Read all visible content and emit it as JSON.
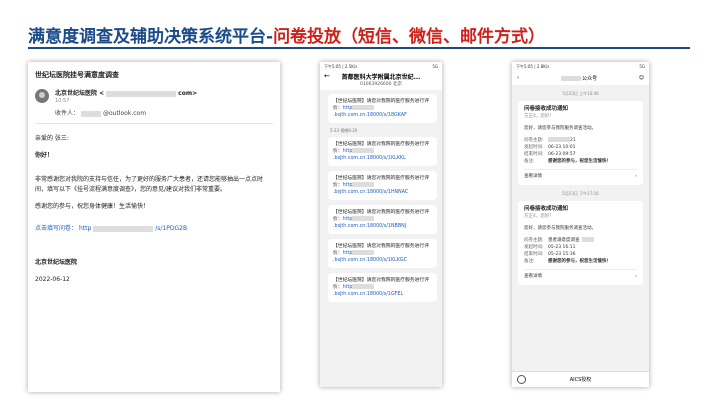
{
  "slide": {
    "title_main": "满意度调查及辅助决策系统平台-",
    "title_highlight": "问卷投放（短信、微信、邮件方式）"
  },
  "email": {
    "subject": "世纪坛医院挂号满意度调查",
    "sender_name": "北京世纪坛医院",
    "sender_addr_open": "<",
    "sender_addr_close": "com>",
    "sent_time": "10:57",
    "recipient_label": "收件人：",
    "recipient_addr": "@outlook.com",
    "greeting": "亲爱的 张三:",
    "hello": "你好！",
    "body1": "非常感谢您对我院的支持与信任，为了更好的服务广大患者，还请您能够抽出一点点时间，填写以下《挂号流程满意度调查》，您的意见/建议对我们非常重要。",
    "body2": "感谢您的参与，祝您身体健康！生活愉快！",
    "link_label": "点击填写问卷：",
    "link_prefix": "http",
    "link_suffix": "/s/1PDG2B",
    "signature": "北京世纪坛医院",
    "date": "2022-06-12"
  },
  "sms": {
    "status_left": "下午5:05 | 2.5K/s",
    "status_right": "5G",
    "header_title": "首都医科大学附属北京世纪...",
    "header_number": "01063926600 北京",
    "time_stamp": "5-23 傍晚6:20",
    "messages": [
      {
        "text": "【世纪坛医院】请您对我院的医疗服务进行评价：",
        "link": "http",
        "url": ".bsjth.com.cn:18000/s/18GKAF"
      },
      {
        "text": "【世纪坛医院】请您对我院的医疗服务进行评价：",
        "link": "http",
        "url": ".bsjth.com.cn:18000/s/1KLKKL"
      },
      {
        "text": "【世纪坛医院】请您对我院的医疗服务进行评价：",
        "link": "http",
        "url": ".bsjth.com.cn:18000/s/1HNNAC"
      },
      {
        "text": "【世纪坛医院】请您对我院的医疗服务进行评价：",
        "link": "http",
        "url": ".bsjth.com.cn:18000/s/1NBBNJ"
      },
      {
        "text": "【世纪坛医院】请您对我院的医疗服务进行评价：",
        "link": "http",
        "url": ".bsjth.com.cn:18000/s/1KLKGC"
      },
      {
        "text": "【世纪坛医院】请您对我院的医疗服务进行评价：",
        "link": "http",
        "url": ".bsjth.com.cn:18000/s/1GFEL"
      }
    ]
  },
  "wechat": {
    "status_left": "下午5:05 | 2.8K/s",
    "status_right": "5G",
    "header_title": "公众号",
    "back_icon": "chevron-left",
    "cards": [
      {
        "time": "5月23日 上午10:46",
        "title": "问卷接收成功通知",
        "greeting": "方正4，您好！",
        "desc": "您好，请您参与我院服务调查活动。",
        "rows": [
          {
            "k": "问卷主题:",
            "v": "21",
            "bold": false
          },
          {
            "k": "发起时间:",
            "v": "06-23 10:01",
            "bold": false
          },
          {
            "k": "结束时间:",
            "v": "06-23 09:57",
            "bold": false
          },
          {
            "k": "备注:",
            "v": "感谢您的参与，祝您生活愉快！",
            "bold": true
          }
        ],
        "more": "查看详情"
      },
      {
        "time": "5月23日 下午17:16",
        "title": "问卷接收成功通知",
        "greeting": "方正4，您好！",
        "desc": "您好，请您参与我院服务调查活动。",
        "rows": [
          {
            "k": "问卷主题:",
            "v": "患者满意度调查",
            "bold": false
          },
          {
            "k": "发起时间:",
            "v": "05-23 16:11",
            "bold": false
          },
          {
            "k": "结束时间:",
            "v": "05-23 15:36",
            "bold": false
          },
          {
            "k": "备注:",
            "v": "感谢您的参与，祝您生活愉快！",
            "bold": true
          }
        ],
        "more": "查看详情"
      }
    ],
    "footer_label": "AICS授权"
  }
}
